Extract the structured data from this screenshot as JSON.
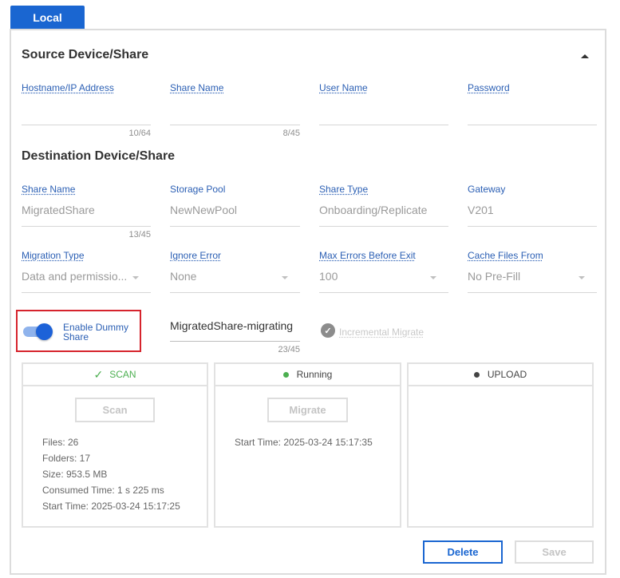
{
  "tab": {
    "label": "Local"
  },
  "source": {
    "title": "Source Device/Share",
    "fields": [
      {
        "label": "Hostname/IP Address",
        "value": "",
        "counter": "10/64"
      },
      {
        "label": "Share Name",
        "value": "",
        "counter": "8/45"
      },
      {
        "label": "User Name",
        "value": ""
      },
      {
        "label": "Password",
        "value": ""
      }
    ]
  },
  "destination": {
    "title": "Destination Device/Share",
    "fields": [
      {
        "label": "Share Name",
        "value": "MigratedShare",
        "counter": "13/45"
      },
      {
        "label": "Storage Pool",
        "value": "NewNewPool"
      },
      {
        "label": "Share Type",
        "value": "Onboarding/Replicate"
      },
      {
        "label": "Gateway",
        "value": "V201"
      }
    ],
    "selects": [
      {
        "label": "Migration Type",
        "value": "Data and permissio..."
      },
      {
        "label": "Ignore Error",
        "value": "None"
      },
      {
        "label": "Max Errors Before Exit",
        "value": "100"
      },
      {
        "label": "Cache Files From",
        "value": "No Pre-Fill"
      }
    ]
  },
  "dummy": {
    "toggle_label": "Enable Dummy Share",
    "toggle_on": true,
    "share_value": "MigratedShare-migrating",
    "share_counter": "23/45",
    "incremental_label": "Incremental Migrate"
  },
  "cards": {
    "scan": {
      "header": "SCAN",
      "button": "Scan",
      "stats": [
        "Files: 26",
        "Folders: 17",
        "Size: 953.5 MB",
        "Consumed Time: 1 s 225 ms",
        "Start Time: 2025-03-24 15:17:25"
      ]
    },
    "migrate": {
      "header": "Running",
      "button": "Migrate",
      "stats": [
        "Start Time: 2025-03-24 15:17:35"
      ]
    },
    "upload": {
      "header": "UPLOAD"
    }
  },
  "actions": {
    "delete": "Delete",
    "save": "Save"
  },
  "colors": {
    "accent": "#1a66d1",
    "success": "#4caf50",
    "highlight": "#d6242d"
  }
}
